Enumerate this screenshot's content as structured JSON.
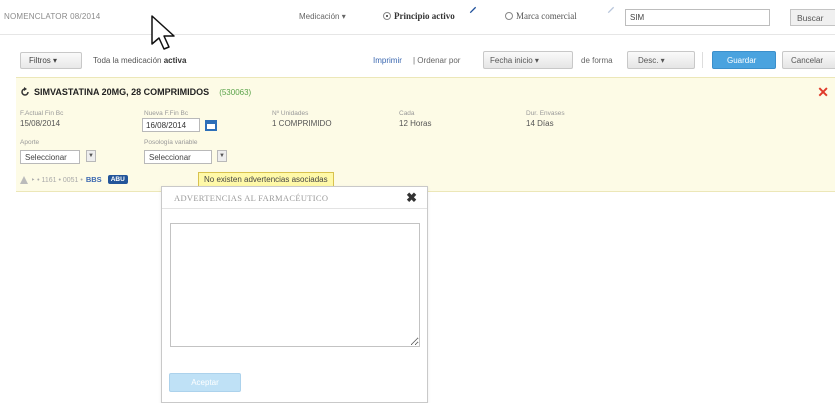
{
  "header": {
    "nomenclator": "NOMENCLATOR 08/2014",
    "medicacion_dropdown": "Medicación ▾",
    "radio_principio": "Principio activo",
    "radio_marca": "Marca comercial",
    "search_value": "SIM",
    "buscar_label": "Buscar"
  },
  "toolbar": {
    "filtros_label": "Filtros ▾",
    "toda_text": "Toda la medicación ",
    "toda_bold": "activa",
    "imprimir": "Imprimir",
    "ordenar": " | Ordenar por",
    "fecha_sort": "Fecha inicio ▾",
    "de_forma": "de forma",
    "desc_sort": "Desc. ▾",
    "guardar_label": "Guardar",
    "cancelar_label": "Cancelar"
  },
  "drug": {
    "name": "SIMVASTATINA 20MG, 28 COMPRIMIDOS",
    "code": "(530063)",
    "fecha_actual_label": "F.Actual Fin Bc",
    "fecha_actual_value": "15/08/2014",
    "nueva_fecha_label": "Nueva F.Fin Bc",
    "nueva_fecha_value": "16/08/2014",
    "unidades_label": "Nº Unidades",
    "unidades_value": "1 COMPRIMIDO",
    "cada_label": "Cada",
    "cada_value": "12 Horas",
    "dur_label": "Dur. Envases",
    "dur_value": "14 Días",
    "aporta_label": "Aporte",
    "aporta_value": "Seleccionar",
    "posologia_label": "Posología variable",
    "posologia_value": "Seleccionar",
    "icon_row_text": "‣ • 1161 • 0051 •",
    "bbs_label": "BBS",
    "abu_label": "ABU",
    "tooltip": "No existen advertencias asociadas"
  },
  "modal": {
    "title": "ADVERTENCIAS AL FARMACÉUTICO",
    "button_label": "Aceptar"
  },
  "colors": {
    "accent": "#4aa3df",
    "panel_bg": "#fdfbe6",
    "close_red": "#e03a2a",
    "code_green": "#5aa34a",
    "tooltip_bg": "#fff9a8"
  }
}
